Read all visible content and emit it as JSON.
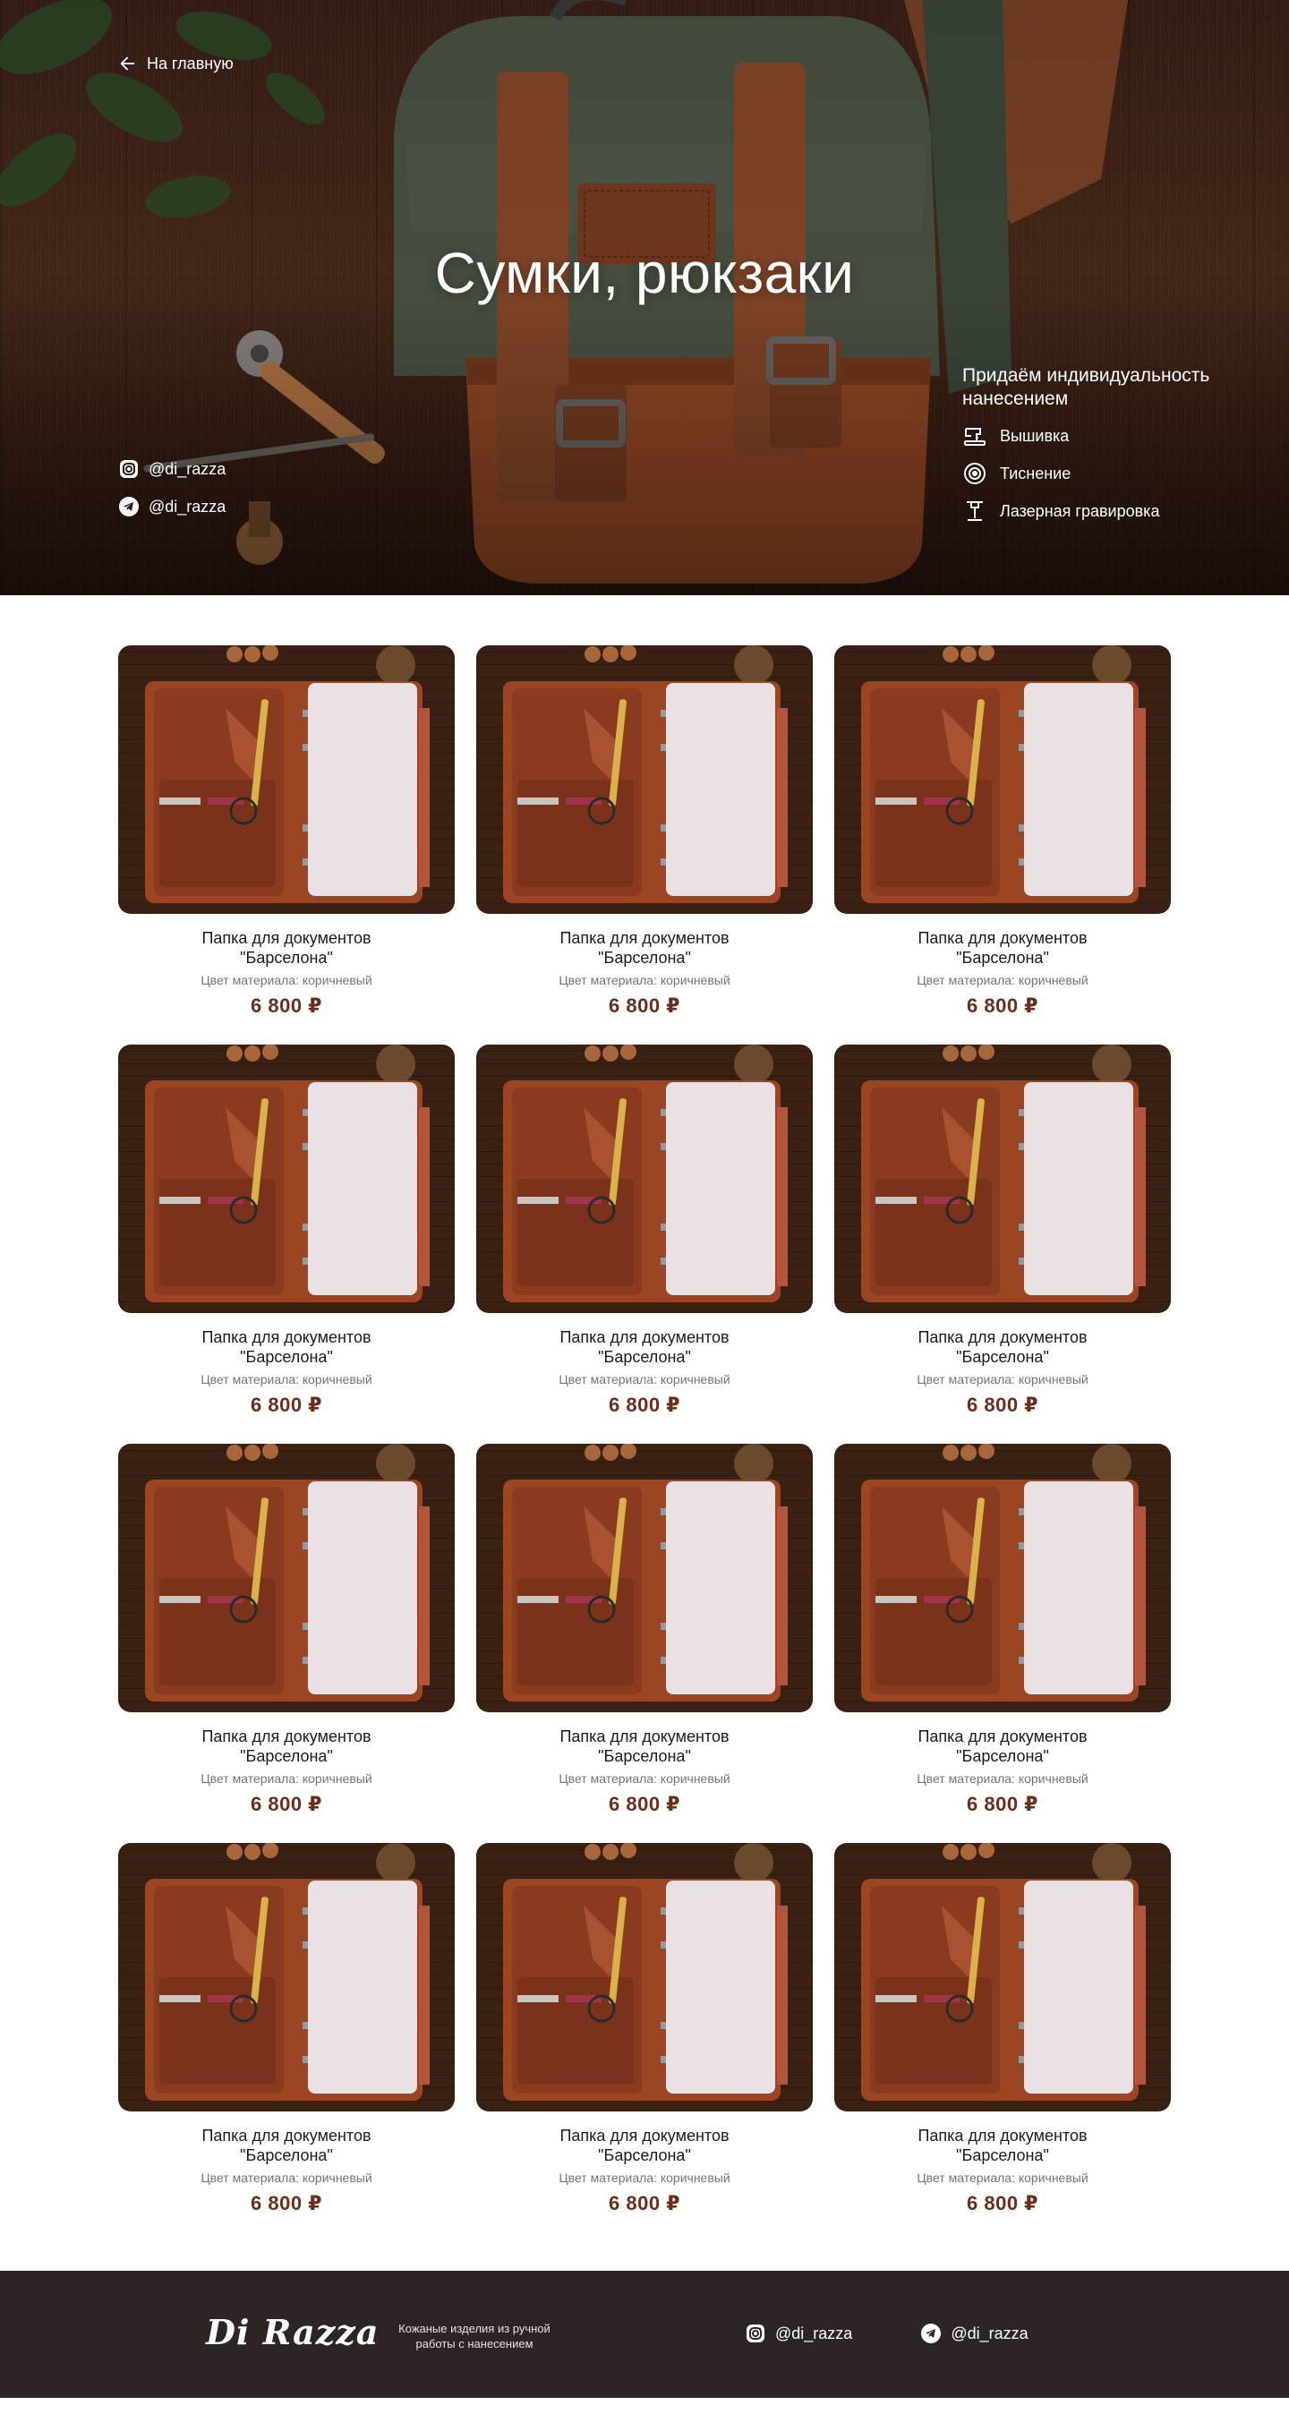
{
  "hero": {
    "back_label": "На главную",
    "title": "Сумки, рюкзаки",
    "socials": [
      {
        "icon": "instagram-icon",
        "handle": "@di_razza"
      },
      {
        "icon": "telegram-icon",
        "handle": "@di_razza"
      }
    ],
    "personalization": {
      "title": "Придаём индивидуальность нанесением",
      "items": [
        {
          "icon": "sewing-machine-icon",
          "label": "Вышивка"
        },
        {
          "icon": "embossing-stamp-icon",
          "label": "Тиснение"
        },
        {
          "icon": "laser-engraving-icon",
          "label": "Лазерная гравировка"
        }
      ]
    }
  },
  "products": [
    {
      "title": "Папка для документов \"Барселона\"",
      "color": "Цвет материала: коричневый",
      "price": "6 800 ₽"
    },
    {
      "title": "Папка для документов \"Барселона\"",
      "color": "Цвет материала: коричневый",
      "price": "6 800 ₽"
    },
    {
      "title": "Папка для документов \"Барселона\"",
      "color": "Цвет материала: коричневый",
      "price": "6 800 ₽"
    },
    {
      "title": "Папка для документов \"Барселона\"",
      "color": "Цвет материала: коричневый",
      "price": "6 800 ₽"
    },
    {
      "title": "Папка для документов \"Барселона\"",
      "color": "Цвет материала: коричневый",
      "price": "6 800 ₽"
    },
    {
      "title": "Папка для документов \"Барселона\"",
      "color": "Цвет материала: коричневый",
      "price": "6 800 ₽"
    },
    {
      "title": "Папка для документов \"Барселона\"",
      "color": "Цвет материала: коричневый",
      "price": "6 800 ₽"
    },
    {
      "title": "Папка для документов \"Барселона\"",
      "color": "Цвет материала: коричневый",
      "price": "6 800 ₽"
    },
    {
      "title": "Папка для документов \"Барселона\"",
      "color": "Цвет материала: коричневый",
      "price": "6 800 ₽"
    },
    {
      "title": "Папка для документов \"Барселона\"",
      "color": "Цвет материала: коричневый",
      "price": "6 800 ₽"
    },
    {
      "title": "Папка для документов \"Барселона\"",
      "color": "Цвет материала: коричневый",
      "price": "6 800 ₽"
    },
    {
      "title": "Папка для документов \"Барселона\"",
      "color": "Цвет материала: коричневый",
      "price": "6 800 ₽"
    }
  ],
  "footer": {
    "brand": "Di Razza",
    "tagline": "Кожаные изделия из ручной работы с нанесением",
    "socials": [
      {
        "icon": "instagram-icon",
        "handle": "@di_razza"
      },
      {
        "icon": "telegram-icon",
        "handle": "@di_razza"
      }
    ]
  },
  "colors": {
    "price": "#6b2e1a",
    "footer_bg": "#2d2523",
    "leather": "#8b3d22"
  }
}
